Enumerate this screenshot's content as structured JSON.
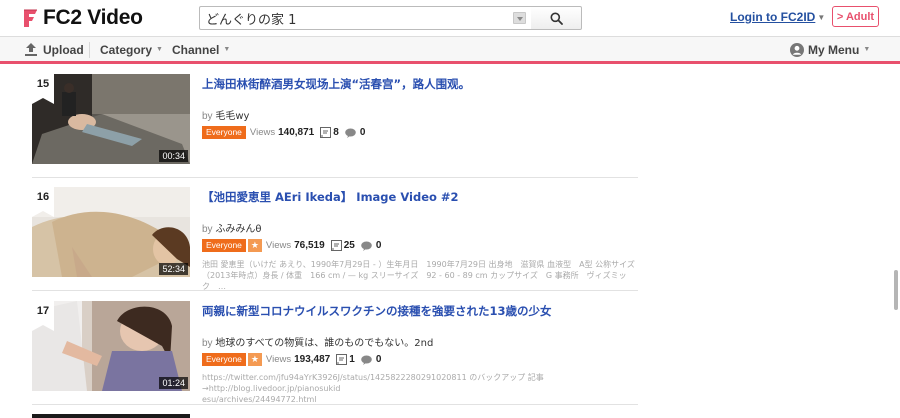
{
  "brand": {
    "name": "FC2 Video",
    "accent": "#e8506d",
    "link": "#2a4fb0"
  },
  "search": {
    "value": "どんぐりの家 1",
    "button_icon": "search-icon"
  },
  "header": {
    "login_label": "Login to FC2ID",
    "adult_label": "> Adult"
  },
  "nav": {
    "upload_label": "Upload",
    "category_label": "Category",
    "channel_label": "Channel",
    "mymenu_label": "My Menu",
    "caret": "▼"
  },
  "videos": [
    {
      "rank": "15",
      "duration": "00:34",
      "title": "上海田林街醉酒男女现场上演“活春宫”，路人围观。",
      "by_label": "by",
      "uploader": "毛毛wy",
      "rating": "Everyone",
      "has_star": false,
      "views_label": "Views",
      "views": "140,871",
      "comments": "8",
      "bubbles": "0",
      "description": []
    },
    {
      "rank": "16",
      "duration": "52:34",
      "title": "【池田愛恵里 AEri Ikeda】 Image Video #2",
      "by_label": "by",
      "uploader": "ふみみんθ",
      "rating": "Everyone",
      "has_star": true,
      "star": "★",
      "views_label": "Views",
      "views": "76,519",
      "comments": "25",
      "bubbles": "0",
      "description": [
        "池田 愛恵里（いけだ あえり、1990年7月29日 - ）生年月日　1990年7月29日 出身地　滋賀県 血液型　A型 公称サイズ",
        "（2013年時点）身長 / 体重　166 cm / — kg スリーサイズ　92 - 60 - 89 cm カップサイズ　G 事務所　ヴィズミック　…"
      ]
    },
    {
      "rank": "17",
      "duration": "01:24",
      "title": "両親に新型コロナウイルスワクチンの接種を強要された13歳の少女",
      "by_label": "by",
      "uploader": "地球のすべての物質は、誰のものでもない。2nd",
      "rating": "Everyone",
      "has_star": true,
      "star": "★",
      "views_label": "Views",
      "views": "193,487",
      "comments": "1",
      "bubbles": "0",
      "description": [
        "https://twitter.com/jfu94aYrK3926J/status/1425822280291020811 のバックアップ 記事→http://blog.livedoor.jp/pianosukid",
        "esu/archives/24494772.html"
      ]
    }
  ]
}
